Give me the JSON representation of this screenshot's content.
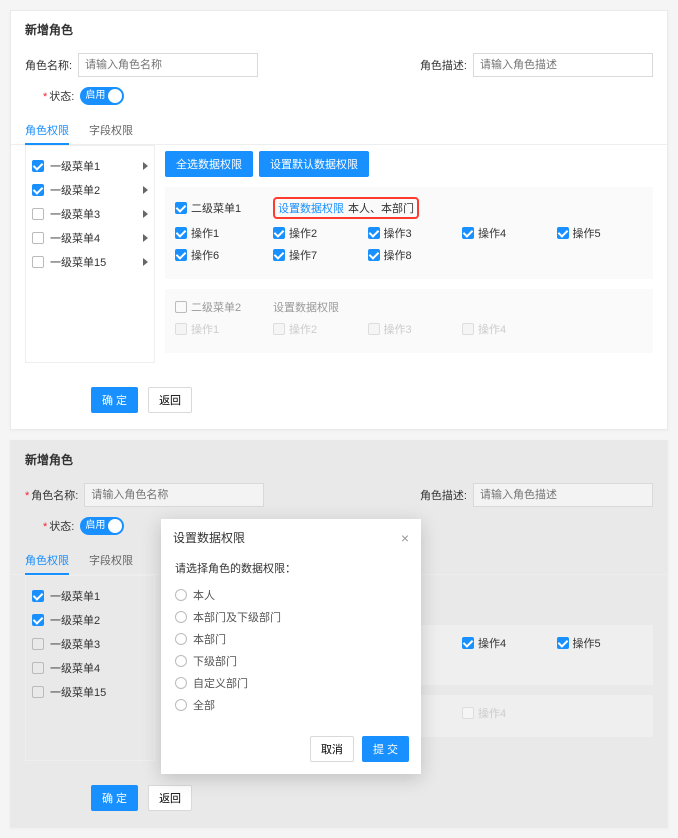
{
  "panel1": {
    "title": "新增角色",
    "form": {
      "role_name_label": "角色名称:",
      "role_name_placeholder": "请输入角色名称",
      "role_desc_label": "角色描述:",
      "role_desc_placeholder": "请输入角色描述",
      "status_label": "状态:",
      "status_text": "启用"
    },
    "tabs": {
      "perm": "角色权限",
      "field": "字段权限"
    },
    "menu": {
      "items": [
        {
          "label": "一级菜单1",
          "checked": true
        },
        {
          "label": "一级菜单2",
          "checked": true
        },
        {
          "label": "一级菜单3",
          "checked": false
        },
        {
          "label": "一级菜单4",
          "checked": false
        },
        {
          "label": "一级菜单15",
          "checked": false
        }
      ]
    },
    "buttons": {
      "select_all": "全选数据权限",
      "set_default": "设置默认数据权限"
    },
    "group1": {
      "head_label": "二级菜单1",
      "set_link": "设置数据权限",
      "set_tail": "本人、本部门",
      "ops": [
        "操作1",
        "操作2",
        "操作3",
        "操作4",
        "操作5",
        "操作6",
        "操作7",
        "操作8"
      ]
    },
    "group2": {
      "head_label": "二级菜单2",
      "set_link": "设置数据权限",
      "ops": [
        "操作1",
        "操作2",
        "操作3",
        "操作4"
      ]
    },
    "footer": {
      "ok": "确 定",
      "back": "返回"
    }
  },
  "panel2": {
    "title": "新增角色",
    "form": {
      "role_name_label": "角色名称:",
      "role_name_placeholder": "请输入角色名称",
      "role_desc_label": "角色描述:",
      "role_desc_placeholder": "请输入角色描述",
      "status_label": "状态:",
      "status_text": "启用"
    },
    "tabs": {
      "perm": "角色权限",
      "field": "字段权限"
    },
    "menu": {
      "items": [
        {
          "label": "一级菜单1",
          "checked": true
        },
        {
          "label": "一级菜单2",
          "checked": true
        },
        {
          "label": "一级菜单3",
          "checked": false
        },
        {
          "label": "一级菜单4",
          "checked": false
        },
        {
          "label": "一级菜单15",
          "checked": false
        }
      ]
    },
    "bg_ops": {
      "op4": "操作4",
      "op5": "操作5",
      "op4b": "操作4"
    },
    "footer": {
      "ok": "确 定",
      "back": "返回"
    },
    "modal": {
      "title": "设置数据权限",
      "prompt": "请选择角色的数据权限：",
      "options": [
        "本人",
        "本部门及下级部门",
        "本部门",
        "下级部门",
        "自定义部门",
        "全部"
      ],
      "cancel": "取消",
      "submit": "提 交"
    }
  }
}
